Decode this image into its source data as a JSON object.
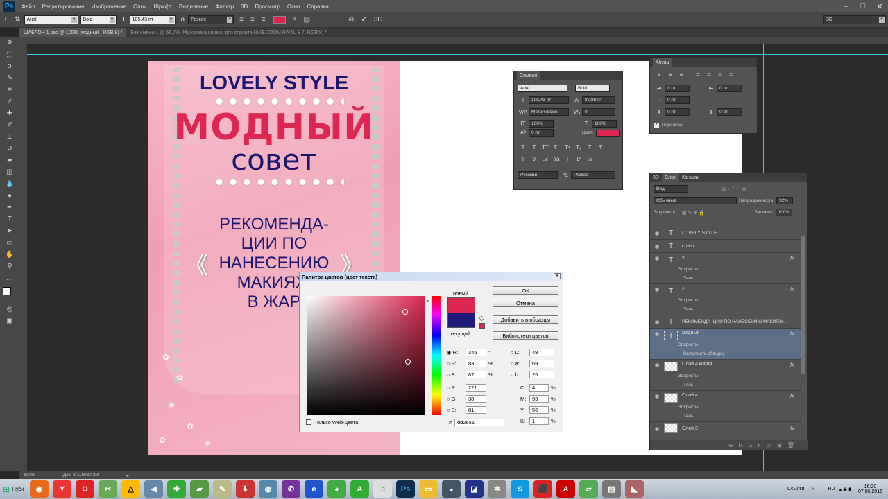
{
  "menubar": {
    "logo": "Ps",
    "items": [
      "Файл",
      "Редактирование",
      "Изображение",
      "Слои",
      "Шрифт",
      "Выделение",
      "Фильтр",
      "3D",
      "Просмотр",
      "Окно",
      "Справка"
    ]
  },
  "options": {
    "font_family": "Arial",
    "font_style": "Bold",
    "font_size": "105,43 пт",
    "anti_alias": "Резкое",
    "text_color": "#dd2651",
    "workspace": "3D"
  },
  "tabs": [
    "ШАБЛОН 1.psd @ 100% (модный , RGB/8) *",
    "Без имени-1 @ 66,7% (Мужские шиповки для спринта NIKE ZOOM RIVAL S 7, RGB/8) *"
  ],
  "document": {
    "brand": "LOVELY STYLE",
    "title": "МОДНЫЙ",
    "subtitle": "совет",
    "body_lines": [
      "РЕКОМЕНДА-",
      "ЦИИ ПО",
      "НАНЕСЕНИЮ",
      "МАКИЯЖ",
      "В ЖАР"
    ],
    "quote_left": "《",
    "quote_right": "》"
  },
  "char_panel": {
    "title": "Символ",
    "font": "Arial",
    "style": "Bold",
    "size": "105,43 пт",
    "leading": "87,86 пт",
    "kerning": "Метрический",
    "tracking": "0",
    "vscale": "100%",
    "hscale": "100%",
    "baseline": "0 пт",
    "color_label": "Цвет:",
    "language": "Русский",
    "aa": "Резкое"
  },
  "para_panel": {
    "title": "Абзац",
    "indent_left": "0 пт",
    "indent_right": "0 пт",
    "indent_first": "0 пт",
    "space_before": "0 пт",
    "space_after": "0 пт",
    "hyphenate": "Переносы"
  },
  "layers_panel": {
    "tabs": [
      "3D",
      "Слои",
      "Каналы"
    ],
    "kind": "Вид",
    "blend": "Обычные",
    "opacity_label": "Непрозрачность:",
    "opacity": "92%",
    "lock_label": "Закрепить:",
    "fill_label": "Заливка:",
    "fill": "100%",
    "effects_label": "Эффекты",
    "shadow_label": "Тень",
    "stroke_label": "Выполнить обводку",
    "layers": [
      {
        "name": "LOVELY STYLE",
        "type": "text"
      },
      {
        "name": "совет",
        "type": "text"
      },
      {
        "name": "«",
        "type": "text",
        "fx": true
      },
      {
        "name": "»",
        "type": "text",
        "fx": true
      },
      {
        "name": "РЕКОМЕНДА- ЦИИ ПО НАНЕСЕНИЮ МАКИЯЖ...",
        "type": "text"
      },
      {
        "name": "модный",
        "type": "text",
        "fx": true
      },
      {
        "name": "Слой 4 копия",
        "type": "image",
        "fx": true
      },
      {
        "name": "Слой 4",
        "type": "image",
        "fx": true
      },
      {
        "name": "Слой 3",
        "type": "image",
        "fx": true
      }
    ]
  },
  "color_picker": {
    "title": "Палитра цветов (цвет текста)",
    "new_label": "новый",
    "current_label": "текущий",
    "ok": "ОК",
    "cancel": "Отмена",
    "add_swatch": "Добавить в образцы",
    "libraries": "Библиотеки цветов",
    "web_only": "Только Web-цвета",
    "new_color": "#dd2651",
    "current_color": "#1f1a7a",
    "H": "346",
    "S": "83",
    "Bv": "87",
    "R": "221",
    "G": "38",
    "B": "81",
    "L": "49",
    "a": "69",
    "b": "25",
    "C": "4",
    "M": "93",
    "Y": "56",
    "K": "1",
    "hex": "dd2651",
    "deg": "°",
    "pct": "%"
  },
  "status": {
    "zoom": "100%",
    "doc": "Док: 3,11M/30,3M"
  },
  "taskbar": {
    "start": "Пуск",
    "links": "Ссылки",
    "lang": "RU",
    "time": "16:20",
    "date": "07.06.2016"
  }
}
